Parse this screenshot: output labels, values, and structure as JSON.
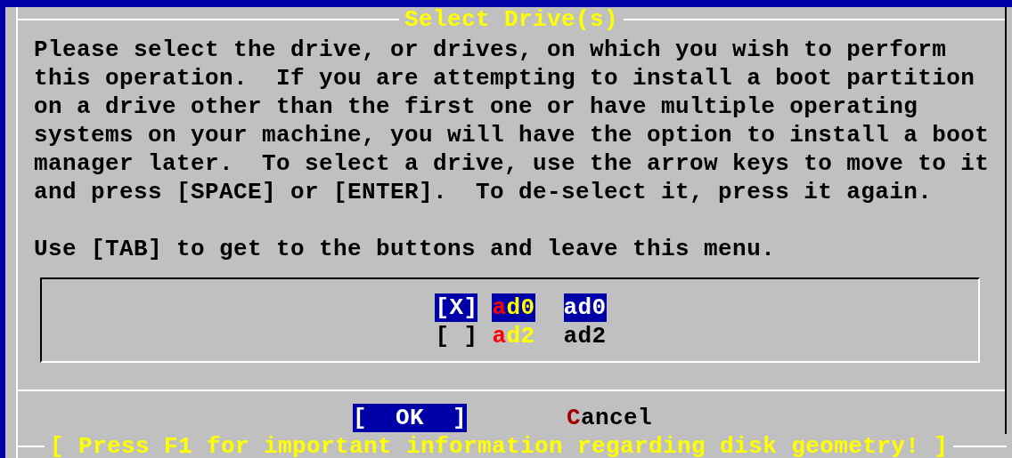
{
  "dialog": {
    "title": "Select Drive(s)",
    "message": "Please select the drive, or drives, on which you wish to perform\nthis operation.  If you are attempting to install a boot partition\non a drive other than the first one or have multiple operating\nsystems on your machine, you will have the option to install a boot\nmanager later.  To select a drive, use the arrow keys to move to it\nand press [SPACE] or [ENTER].  To de-select it, press it again.",
    "hint": "Use [TAB] to get to the buttons and leave this menu.",
    "drives": [
      {
        "mark": "[X]",
        "name": "ad0",
        "description": "ad0",
        "selected": true
      },
      {
        "mark": "[ ]",
        "name": "ad2",
        "description": "ad2",
        "selected": false
      }
    ],
    "buttons": [
      {
        "label": "[  OK  ]",
        "selected": true
      },
      {
        "label": "Cancel",
        "selected": false
      }
    ],
    "footer": "[ Press F1 for important information regarding disk geometry! ]"
  }
}
